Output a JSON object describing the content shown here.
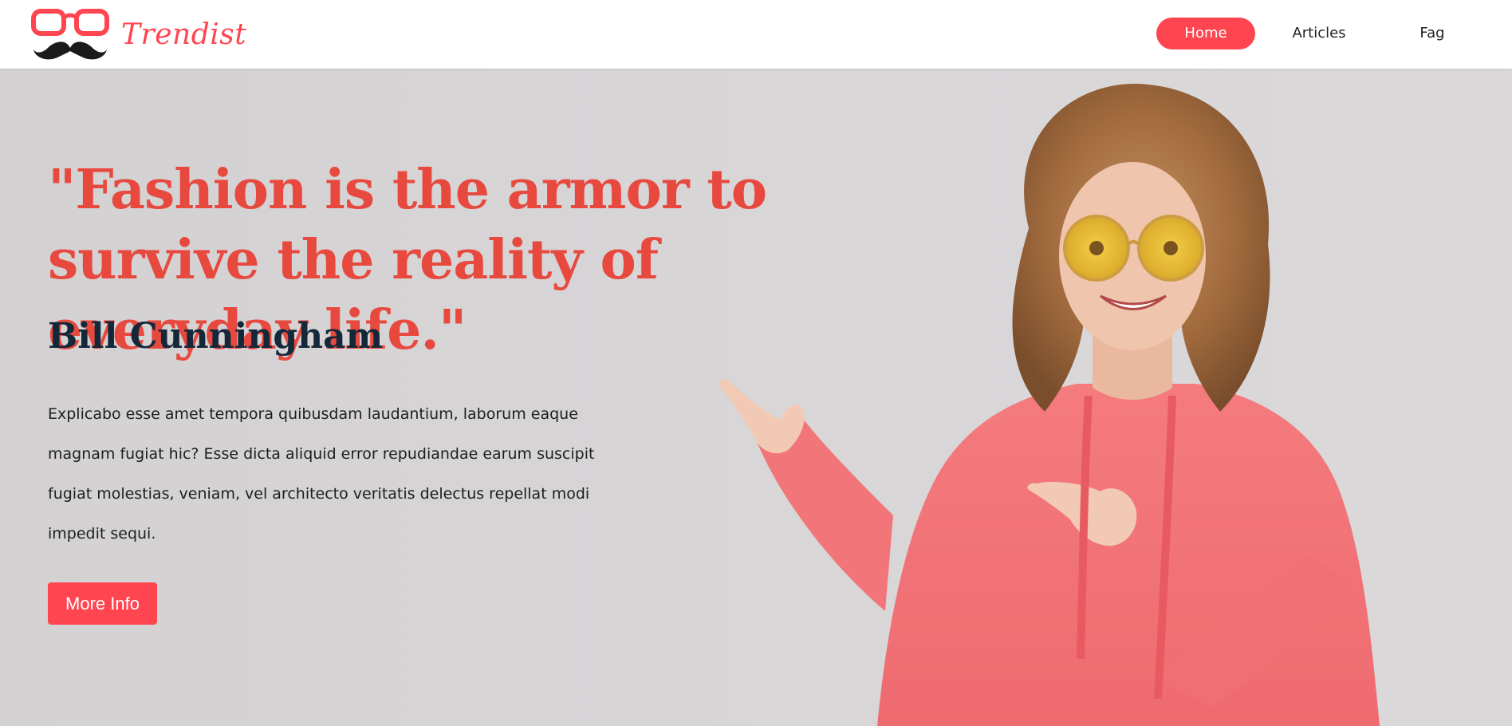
{
  "brand": {
    "name": "Trendist",
    "logo_icon": "glasses-mustache-icon"
  },
  "nav": {
    "items": [
      {
        "label": "Home",
        "active": true
      },
      {
        "label": "Articles",
        "active": false
      },
      {
        "label": "Fag",
        "active": false
      }
    ]
  },
  "hero": {
    "quote": "\"Fashion is the armor to survive the reality of everyday life.\"",
    "author": "Bill Cunningham",
    "description": "Explicabo esse amet tempora quibusdam laudantium, laborum eaque magnam fugiat hic? Esse dicta aliquid error repudiandae earum suscipit fugiat molestias, veniam, vel architecto veritatis delectus repellat modi impedit sequi.",
    "button_label": "More Info",
    "image": "woman-pink-hoodie-pointing-photo"
  },
  "colors": {
    "accent": "#ff4550",
    "quote": "#e8493f",
    "author": "#14283a",
    "hero_bg": "#d6d4d5",
    "hoodie": "#f47478"
  }
}
